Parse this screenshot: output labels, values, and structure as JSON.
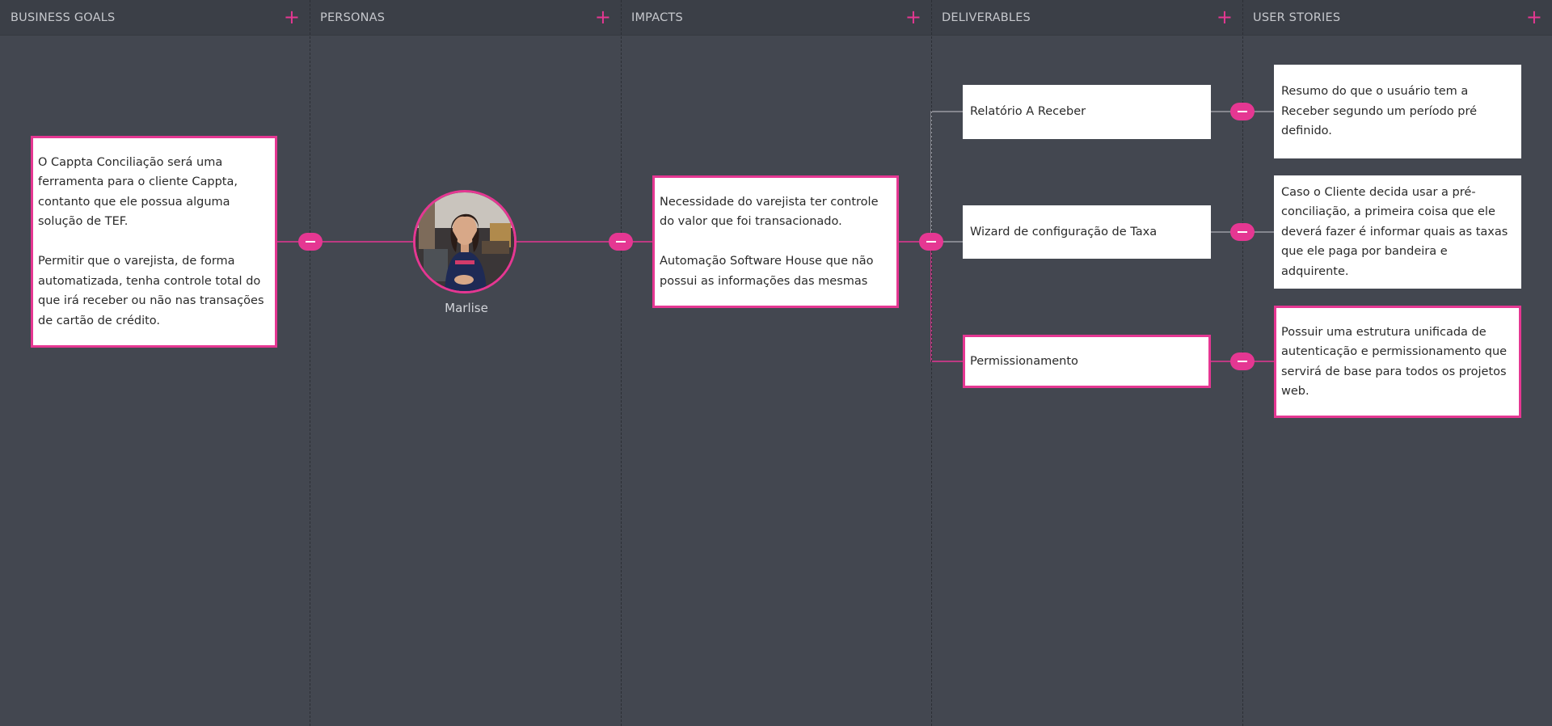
{
  "columns": [
    {
      "title": "BUSINESS GOALS",
      "add_icon": "plus-icon"
    },
    {
      "title": "PERSONAS",
      "add_icon": "plus-icon"
    },
    {
      "title": "IMPACTS",
      "add_icon": "plus-icon"
    },
    {
      "title": "DELIVERABLES",
      "add_icon": "plus-icon"
    },
    {
      "title": "USER STORIES",
      "add_icon": "plus-icon"
    }
  ],
  "business_goal": {
    "paragraphs": [
      "O Cappta Conciliação será uma ferramenta para o cliente Cappta, contanto que ele possua alguma solução de TEF.",
      "Permitir que o varejista, de forma automatizada, tenha controle total do que irá receber ou não nas transações de cartão de crédito."
    ]
  },
  "persona": {
    "name": "Marlise",
    "avatar": "persona-photo"
  },
  "impact": {
    "paragraphs": [
      "Necessidade do varejista ter controle do valor que foi transacionado.",
      "Automação Software House que não possui as informações das mesmas"
    ]
  },
  "deliverables": [
    {
      "label": "Relatório A Receber"
    },
    {
      "label": "Wizard de configuração de Taxa"
    },
    {
      "label": "Permissionamento"
    }
  ],
  "user_stories": [
    {
      "text": "Resumo do que o usuário tem a Receber segundo um período pré definido."
    },
    {
      "text": "Caso o Cliente decida usar a pré-conciliação, a primeira coisa que ele deverá fazer é informar quais as taxas que ele paga por bandeira e adquirente."
    },
    {
      "text": "Possuir uma estrutura unificada de autenticação e permissionamento que servirá de base para todos os projetos web."
    }
  ],
  "colors": {
    "accent": "#e53792",
    "background": "#434750",
    "header": "#3b3f47"
  }
}
